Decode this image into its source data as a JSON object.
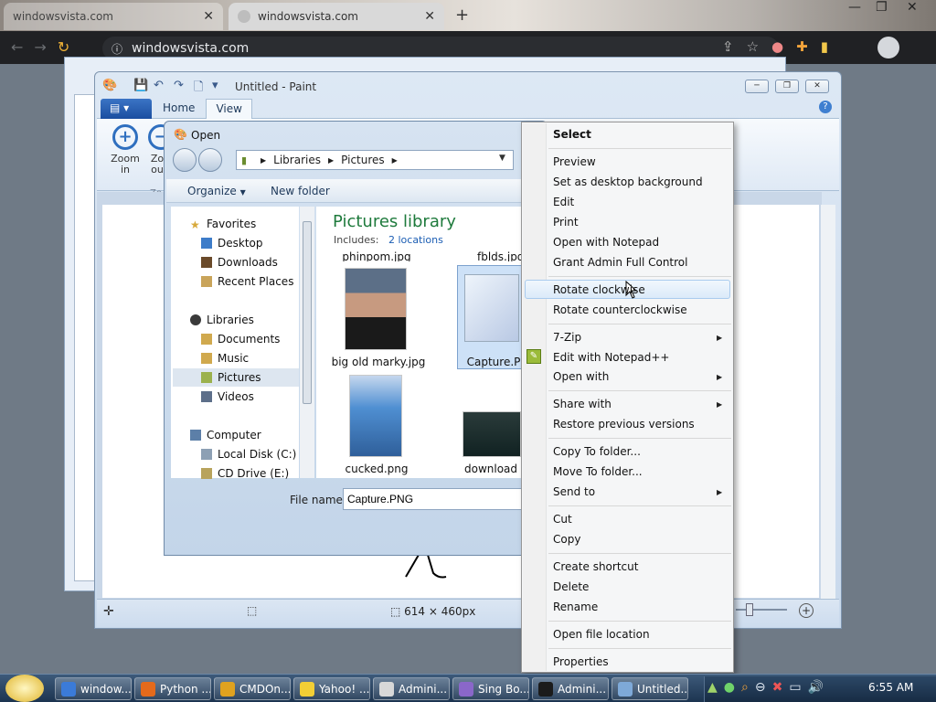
{
  "browser": {
    "tabs": [
      {
        "label": "windowsvista.com",
        "close": "✕"
      },
      {
        "label": "windowsvista.com",
        "close": "✕"
      }
    ],
    "new_tab": "+",
    "window_controls": [
      "—",
      "❐",
      "✕"
    ],
    "url": "windowsvista.com",
    "nav_icons": [
      "back-icon",
      "forward-icon",
      "reload-icon",
      "info-icon"
    ],
    "extension_icons": [
      "share-icon",
      "star-icon",
      "flag-icon",
      "puzzle-icon",
      "sidebar-icon"
    ]
  },
  "paint": {
    "title": "Untitled - Paint",
    "ribbon_tabs": [
      "Home",
      "View"
    ],
    "zoom_in": "Zoom in",
    "zoom_out_partial": "Zo ou",
    "group_partial": "Zo",
    "status_dimensions": "614 × 460px",
    "window_buttons": [
      "─",
      "❐",
      "✕"
    ]
  },
  "dialog": {
    "title": "Open",
    "breadcrumb": [
      "Libraries",
      "Pictures"
    ],
    "organize": "Organize",
    "new_folder": "New folder",
    "nav": {
      "favorites": "Favorites",
      "favorites_items": [
        "Desktop",
        "Downloads",
        "Recent Places"
      ],
      "libraries": "Libraries",
      "libraries_items": [
        "Documents",
        "Music",
        "Pictures",
        "Videos"
      ],
      "computer": "Computer",
      "computer_items": [
        "Local Disk (C:)",
        "CD Drive (E:)"
      ]
    },
    "library_title": "Pictures library",
    "includes_label": "Includes:",
    "includes_link": "2 locations",
    "files": [
      {
        "name": "phinpom.jpg"
      },
      {
        "name": "fblds.jpg"
      },
      {
        "name": "big old marky.jpg"
      },
      {
        "name": "Capture.P"
      },
      {
        "name": "cucked.png"
      },
      {
        "name": "download"
      }
    ],
    "file_name_label": "File name:",
    "file_name_value": "Capture.PNG"
  },
  "context_menu": {
    "items": [
      {
        "label": "Select",
        "bold": true
      },
      {
        "label": "Preview"
      },
      {
        "label": "Set as desktop background"
      },
      {
        "label": "Edit"
      },
      {
        "label": "Print"
      },
      {
        "label": "Open with Notepad"
      },
      {
        "label": "Grant Admin Full Control"
      },
      {
        "label": "Rotate clockwise"
      },
      {
        "label": "Rotate counterclockwise"
      },
      {
        "label": "7-Zip",
        "submenu": true
      },
      {
        "label": "Edit with Notepad++"
      },
      {
        "label": "Open with",
        "submenu": true
      },
      {
        "label": "Share with",
        "submenu": true
      },
      {
        "label": "Restore previous versions"
      },
      {
        "label": "Copy To folder..."
      },
      {
        "label": "Move To folder..."
      },
      {
        "label": "Send to",
        "submenu": true
      },
      {
        "label": "Cut"
      },
      {
        "label": "Copy"
      },
      {
        "label": "Create shortcut"
      },
      {
        "label": "Delete"
      },
      {
        "label": "Rename"
      },
      {
        "label": "Open file location"
      },
      {
        "label": "Properties"
      }
    ],
    "highlighted": "Rotate clockwise"
  },
  "taskbar": {
    "items": [
      {
        "label": "window...",
        "color": "#3b7bd8"
      },
      {
        "label": "Python ...",
        "color": "#e46a1c"
      },
      {
        "label": "CMDOn...",
        "color": "#e0a21f"
      },
      {
        "label": "Yahoo! ...",
        "color": "#f3cf35"
      },
      {
        "label": "Admini...",
        "color": "#d8d8d8"
      },
      {
        "label": "Sing Bo...",
        "color": "#8a67c9"
      },
      {
        "label": "Admini...",
        "color": "#1b1b1b"
      },
      {
        "label": "Untitled...",
        "color": "#7ea9d8"
      }
    ],
    "clock": "6:55 AM",
    "tray_icons": [
      "cursor-icon",
      "onedrive-icon",
      "search-icon",
      "minus-icon",
      "network-icon",
      "monitor-icon",
      "volume-icon"
    ]
  },
  "colors": {
    "accent": "#1b5db3",
    "library_title": "#1e7a3c",
    "menu_highlight": "#dbeaf9"
  }
}
